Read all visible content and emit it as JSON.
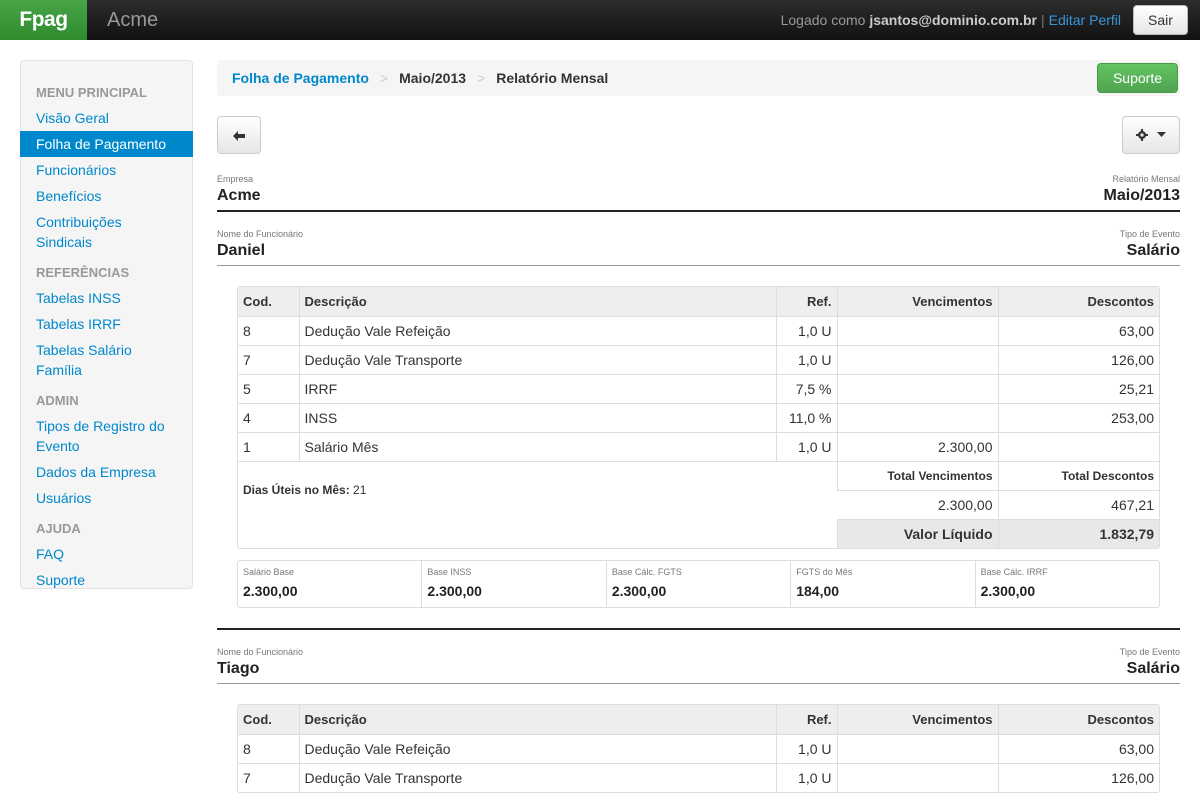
{
  "navbar": {
    "brand": "Fpag",
    "app_name": "Acme",
    "login_prefix": "Logado como",
    "user_email": "jsantos@dominio.com.br",
    "separator": "|",
    "edit_profile": "Editar Perfil",
    "logout": "Sair"
  },
  "sidebar": {
    "sections": [
      {
        "header": "MENU PRINCIPAL",
        "items": [
          "Visão Geral",
          "Folha de Pagamento",
          "Funcionários",
          "Benefícios",
          "Contribuições Sindicais"
        ]
      },
      {
        "header": "REFERÊNCIAS",
        "items": [
          "Tabelas INSS",
          "Tabelas IRRF",
          "Tabelas Salário Família"
        ]
      },
      {
        "header": "ADMIN",
        "items": [
          "Tipos de Registro do Evento",
          "Dados da Empresa",
          "Usuários"
        ]
      },
      {
        "header": "AJUDA",
        "items": [
          "FAQ",
          "Suporte"
        ]
      }
    ],
    "active_item": "Folha de Pagamento"
  },
  "breadcrumb": {
    "items": [
      "Folha de Pagamento",
      "Maio/2013",
      "Relatório Mensal"
    ],
    "divider": ">",
    "support_button": "Suporte"
  },
  "toolbar": {
    "back_icon": "arrow-left-icon",
    "gear_icon": "gear-icon",
    "caret_icon": "caret-down-icon"
  },
  "report": {
    "company_label": "Empresa",
    "company": "Acme",
    "report_label": "Relatório Mensal",
    "period": "Maio/2013"
  },
  "table_headers": {
    "cod": "Cod.",
    "desc": "Descrição",
    "ref": "Ref.",
    "venc": "Vencimentos",
    "desc_col": "Descontos"
  },
  "employees": [
    {
      "name_label": "Nome do Funcionário",
      "name": "Daniel",
      "event_label": "Tipo de Evento",
      "event": "Salário",
      "rows": [
        {
          "cod": "8",
          "desc": "Dedução Vale Refeição",
          "ref": "1,0 U",
          "venc": "",
          "disc": "63,00"
        },
        {
          "cod": "7",
          "desc": "Dedução Vale Transporte",
          "ref": "1,0 U",
          "venc": "",
          "disc": "126,00"
        },
        {
          "cod": "5",
          "desc": "IRRF",
          "ref": "7,5 %",
          "venc": "",
          "disc": "25,21"
        },
        {
          "cod": "4",
          "desc": "INSS",
          "ref": "11,0 %",
          "venc": "",
          "disc": "253,00"
        },
        {
          "cod": "1",
          "desc": "Salário Mês",
          "ref": "1,0 U",
          "venc": "2.300,00",
          "disc": ""
        }
      ],
      "dias_label": "Dias Úteis no Mês:",
      "dias": "21",
      "total_venc_label": "Total Vencimentos",
      "total_desc_label": "Total Descontos",
      "total_venc": "2.300,00",
      "total_desc": "467,21",
      "liquido_label": "Valor Líquido",
      "liquido": "1.832,79",
      "bases": [
        {
          "label": "Salário Base",
          "value": "2.300,00"
        },
        {
          "label": "Base INSS",
          "value": "2.300,00"
        },
        {
          "label": "Base Cálc. FGTS",
          "value": "2.300,00"
        },
        {
          "label": "FGTS do Mês",
          "value": "184,00"
        },
        {
          "label": "Base Cálc. IRRF",
          "value": "2.300,00"
        }
      ]
    },
    {
      "name_label": "Nome do Funcionário",
      "name": "Tiago",
      "event_label": "Tipo de Evento",
      "event": "Salário",
      "rows": [
        {
          "cod": "8",
          "desc": "Dedução Vale Refeição",
          "ref": "1,0 U",
          "venc": "",
          "disc": "63,00"
        },
        {
          "cod": "7",
          "desc": "Dedução Vale Transporte",
          "ref": "1,0 U",
          "venc": "",
          "disc": "126,00"
        }
      ]
    }
  ]
}
